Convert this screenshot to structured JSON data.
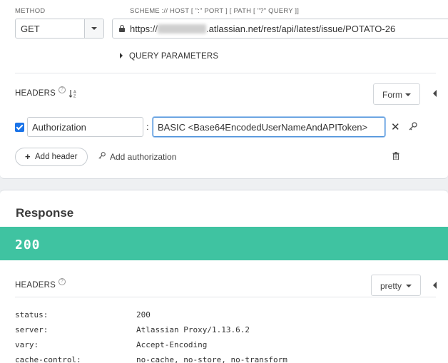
{
  "request": {
    "method_label": "METHOD",
    "method_value": "GET",
    "url_label": "SCHEME :// HOST [ \":\" PORT ] [ PATH [ \"?\" QUERY ]]",
    "url_prefix": "https://",
    "url_suffix": ".atlassian.net/rest/api/latest/issue/POTATO-26",
    "query_params_label": "QUERY PARAMETERS",
    "headers_label": "HEADERS",
    "headers_mode": "Form",
    "header_rows": [
      {
        "enabled": true,
        "name": "Authorization",
        "value": "BASIC <Base64EncodedUserNameAndAPIToken>"
      }
    ],
    "add_header_label": "Add header",
    "add_auth_label": "Add authorization"
  },
  "response": {
    "title": "Response",
    "status": "200",
    "status_color": "#3fc3a1",
    "headers_label": "HEADERS",
    "headers_mode": "pretty",
    "headers": [
      {
        "key": "status:",
        "value": "200"
      },
      {
        "key": "server:",
        "value": "Atlassian Proxy/1.13.6.2"
      },
      {
        "key": "vary:",
        "value": "Accept-Encoding"
      },
      {
        "key": "cache-control:",
        "value": "no-cache, no-store, no-transform"
      }
    ]
  },
  "icons": [
    "lock-icon",
    "chevron-right-icon",
    "help-icon",
    "sort-icon",
    "checkbox-icon",
    "close-icon",
    "key-icon",
    "plus-icon",
    "trash-icon",
    "collapse-icon"
  ]
}
